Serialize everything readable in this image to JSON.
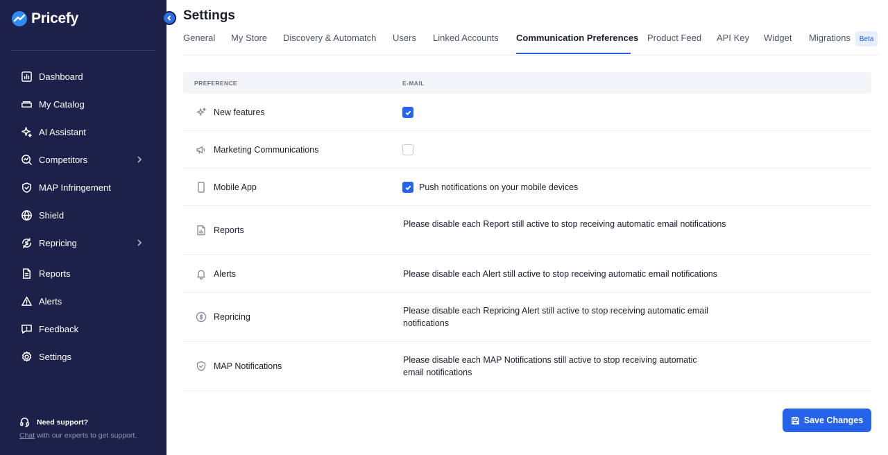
{
  "app": {
    "name": "Pricefy"
  },
  "sidebar": {
    "items": [
      {
        "label": "Dashboard",
        "icon": "dashboard-icon"
      },
      {
        "label": "My Catalog",
        "icon": "catalog-icon"
      },
      {
        "label": "AI Assistant",
        "icon": "sparkle-icon"
      },
      {
        "label": "Competitors",
        "icon": "competitors-icon",
        "expandable": true
      },
      {
        "label": "MAP Infringement",
        "icon": "shield-check-icon"
      },
      {
        "label": "Shield",
        "icon": "globe-icon"
      },
      {
        "label": "Repricing",
        "icon": "repricing-icon",
        "expandable": true
      },
      {
        "label": "Reports",
        "icon": "report-icon"
      },
      {
        "label": "Alerts",
        "icon": "alert-triangle-icon"
      },
      {
        "label": "Feedback",
        "icon": "feedback-icon"
      },
      {
        "label": "Settings",
        "icon": "gear-icon"
      }
    ],
    "support": {
      "title": "Need support?",
      "link": "Chat",
      "text": " with our experts to get support."
    }
  },
  "page": {
    "title": "Settings"
  },
  "tabs": [
    {
      "label": "General"
    },
    {
      "label": "My Store"
    },
    {
      "label": "Discovery & Automatch"
    },
    {
      "label": "Users"
    },
    {
      "label": "Linked Accounts"
    },
    {
      "label": "Communication Preferences",
      "active": true
    },
    {
      "label": "Product Feed"
    },
    {
      "label": "API Key"
    },
    {
      "label": "Widget"
    },
    {
      "label": "Migrations",
      "badge": "Beta"
    }
  ],
  "table": {
    "headers": {
      "preference": "PREFERENCE",
      "email": "E-MAIL"
    },
    "rows": [
      {
        "label": "New features",
        "icon": "sparkle-icon",
        "type": "checkbox",
        "checked": true
      },
      {
        "label": "Marketing Communications",
        "icon": "megaphone-icon",
        "type": "checkbox",
        "checked": false
      },
      {
        "label": "Mobile App",
        "icon": "mobile-icon",
        "type": "checkbox",
        "checked": true,
        "text": "Push notifications on your mobile devices"
      },
      {
        "label": "Reports",
        "icon": "report-icon",
        "type": "text",
        "text": "Please disable each Report still active to stop receiving automatic email notifications"
      },
      {
        "label": "Alerts",
        "icon": "bell-icon",
        "type": "text",
        "text": "Please disable each Alert still active to stop receiving automatic email notifications"
      },
      {
        "label": "Repricing",
        "icon": "repricing-icon",
        "type": "text",
        "text": "Please disable each Repricing Alert still active to stop receiving automatic email notifications"
      },
      {
        "label": "MAP Notifications",
        "icon": "shield-check-icon",
        "type": "text",
        "text": "Please disable each MAP Notifications still active to stop receiving automatic email notifications"
      }
    ]
  },
  "actions": {
    "save_label": "Save Changes"
  },
  "colors": {
    "sidebar": "#1d2149",
    "accent": "#2563eb"
  }
}
